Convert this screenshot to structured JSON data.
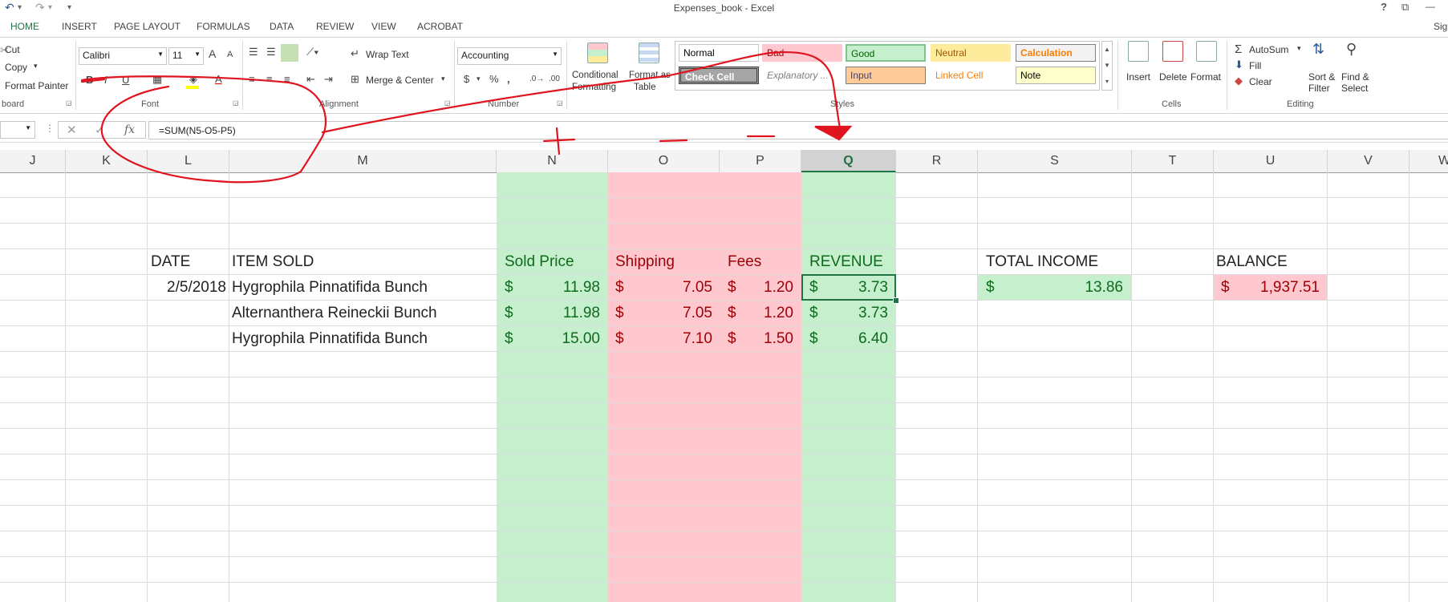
{
  "window": {
    "title": "Expenses_book - Excel",
    "help": "?",
    "restore": "⧉",
    "sign_in": "Sig"
  },
  "qat": {
    "undo": "↶",
    "redo": "↷",
    "customize": "▾"
  },
  "tabs": [
    "HOME",
    "INSERT",
    "PAGE LAYOUT",
    "FORMULAS",
    "DATA",
    "REVIEW",
    "VIEW",
    "ACROBAT"
  ],
  "clipboard": {
    "cut": "Cut",
    "copy": "Copy",
    "format_painter": "Format Painter",
    "group": "board"
  },
  "font": {
    "name": "Calibri",
    "size": "11",
    "grow": "A",
    "shrink": "A",
    "bold": "B",
    "italic": "I",
    "underline": "U",
    "color_letter": "A",
    "group": "Font"
  },
  "alignment": {
    "wrap_text": "Wrap Text",
    "merge_center": "Merge & Center",
    "group": "Alignment"
  },
  "number": {
    "format": "Accounting",
    "currency": "$",
    "percent": "%",
    "comma": ",",
    "group": "Number"
  },
  "styles": {
    "conditional": [
      "Conditional",
      "Formatting"
    ],
    "format_table": [
      "Format as",
      "Table"
    ],
    "cells": [
      {
        "label": "Normal",
        "bg": "#ffffff",
        "fg": "#000000",
        "border": "#c6c6c6"
      },
      {
        "label": "Bad",
        "bg": "#ffc7ce",
        "fg": "#9c0006",
        "border": "#ffc7ce"
      },
      {
        "label": "Good",
        "bg": "#c6efce",
        "fg": "#006100",
        "border": "#7fc48a"
      },
      {
        "label": "Neutral",
        "bg": "#ffeb9c",
        "fg": "#9c5700",
        "border": "#ffeb9c"
      },
      {
        "label": "Calculation",
        "bg": "#f2f2f2",
        "fg": "#fa7d00",
        "border": "#7f7f7f"
      },
      {
        "label": "Check Cell",
        "bg": "#a5a5a5",
        "fg": "#ffffff",
        "border": "#3f3f3f"
      },
      {
        "label": "Explanatory ...",
        "bg": "#ffffff",
        "fg": "#7f7f7f",
        "border": "#ffffff"
      },
      {
        "label": "Input",
        "bg": "#ffcc99",
        "fg": "#3f3f76",
        "border": "#7f7f7f"
      },
      {
        "label": "Linked Cell",
        "bg": "#ffffff",
        "fg": "#fa7d00",
        "border": "#ffffff"
      },
      {
        "label": "Note",
        "bg": "#ffffcc",
        "fg": "#000000",
        "border": "#b2b2b2"
      }
    ],
    "group": "Styles"
  },
  "cells_group": {
    "insert": "Insert",
    "delete": "Delete",
    "format": "Format",
    "group": "Cells"
  },
  "editing": {
    "autosum": "AutoSum",
    "fill": "Fill",
    "clear": "Clear",
    "sort_filter": [
      "Sort &",
      "Filter"
    ],
    "find_select": [
      "Find &",
      "Select"
    ],
    "group": "Editing"
  },
  "formula_bar": {
    "name_box": "",
    "fx": "fx",
    "cancel": "✕",
    "enter": "✓",
    "formula": "=SUM(N5-O5-P5)"
  },
  "columns": [
    "J",
    "K",
    "L",
    "M",
    "N",
    "O",
    "P",
    "Q",
    "R",
    "S",
    "T",
    "U",
    "V",
    "W"
  ],
  "selected_column": "Q",
  "sheet": {
    "headers": {
      "date": "DATE",
      "item": "ITEM SOLD",
      "sold_price": "Sold Price",
      "shipping": "Shipping",
      "fees": "Fees",
      "revenue": "REVENUE",
      "total_income": "TOTAL INCOME",
      "balance": "BALANCE"
    },
    "rows": [
      {
        "date": "2/5/2018",
        "item": "Hygrophila Pinnatifida Bunch",
        "sold": "11.98",
        "shipping": "7.05",
        "fees": "1.20",
        "revenue": "3.73"
      },
      {
        "date": "",
        "item": "Alternanthera Reineckii Bunch",
        "sold": "11.98",
        "shipping": "7.05",
        "fees": "1.20",
        "revenue": "3.73"
      },
      {
        "date": "",
        "item": "Hygrophila Pinnatifida Bunch",
        "sold": "15.00",
        "shipping": "7.10",
        "fees": "1.50",
        "revenue": "6.40"
      }
    ],
    "currency_symbol": "$",
    "total_income": "13.86",
    "balance": "1,937.51"
  },
  "colors": {
    "accent": "#217346",
    "good_fill": "#c6efce",
    "bad_fill": "#ffc7ce",
    "annotation": "#e0141e"
  }
}
